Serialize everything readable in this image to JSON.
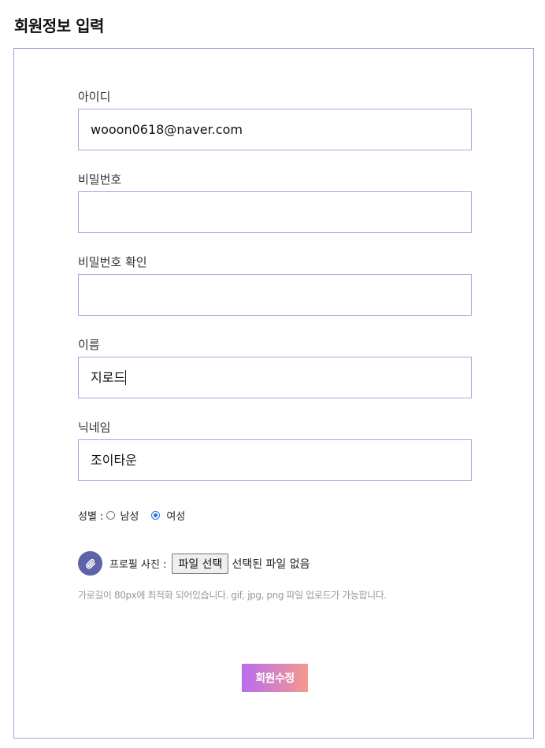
{
  "page": {
    "title": "회원정보 입력"
  },
  "form": {
    "fields": [
      {
        "label": "아이디",
        "value": "wooon0618@naver.com",
        "type": "text"
      },
      {
        "label": "비밀번호",
        "value": "",
        "type": "password"
      },
      {
        "label": "비밀번호 확인",
        "value": "",
        "type": "password"
      },
      {
        "label": "이름",
        "value": "지로드",
        "type": "text"
      },
      {
        "label": "닉네임",
        "value": "조이타운",
        "type": "text"
      }
    ],
    "gender": {
      "label": "성별 :",
      "options": [
        {
          "label": "남성",
          "checked": false
        },
        {
          "label": "여성",
          "checked": true
        }
      ]
    },
    "profile": {
      "label": "프로필 사진 :",
      "button_label": "파일 선택",
      "status": "선택된 파일 없음",
      "icon": "paperclip-icon",
      "hint": "가로길이 80px에 최적화 되어있습니다. gif, jpg, png 파일 업로드가 가능합니다."
    },
    "submit_label": "회원수정"
  },
  "colors": {
    "border": "#a8a4d8",
    "clip_icon_bg": "#5c63a8",
    "submit_gradient_start": "#b86cf0",
    "submit_gradient_end": "#f49a8e",
    "radio_checked": "#1a73e8"
  }
}
